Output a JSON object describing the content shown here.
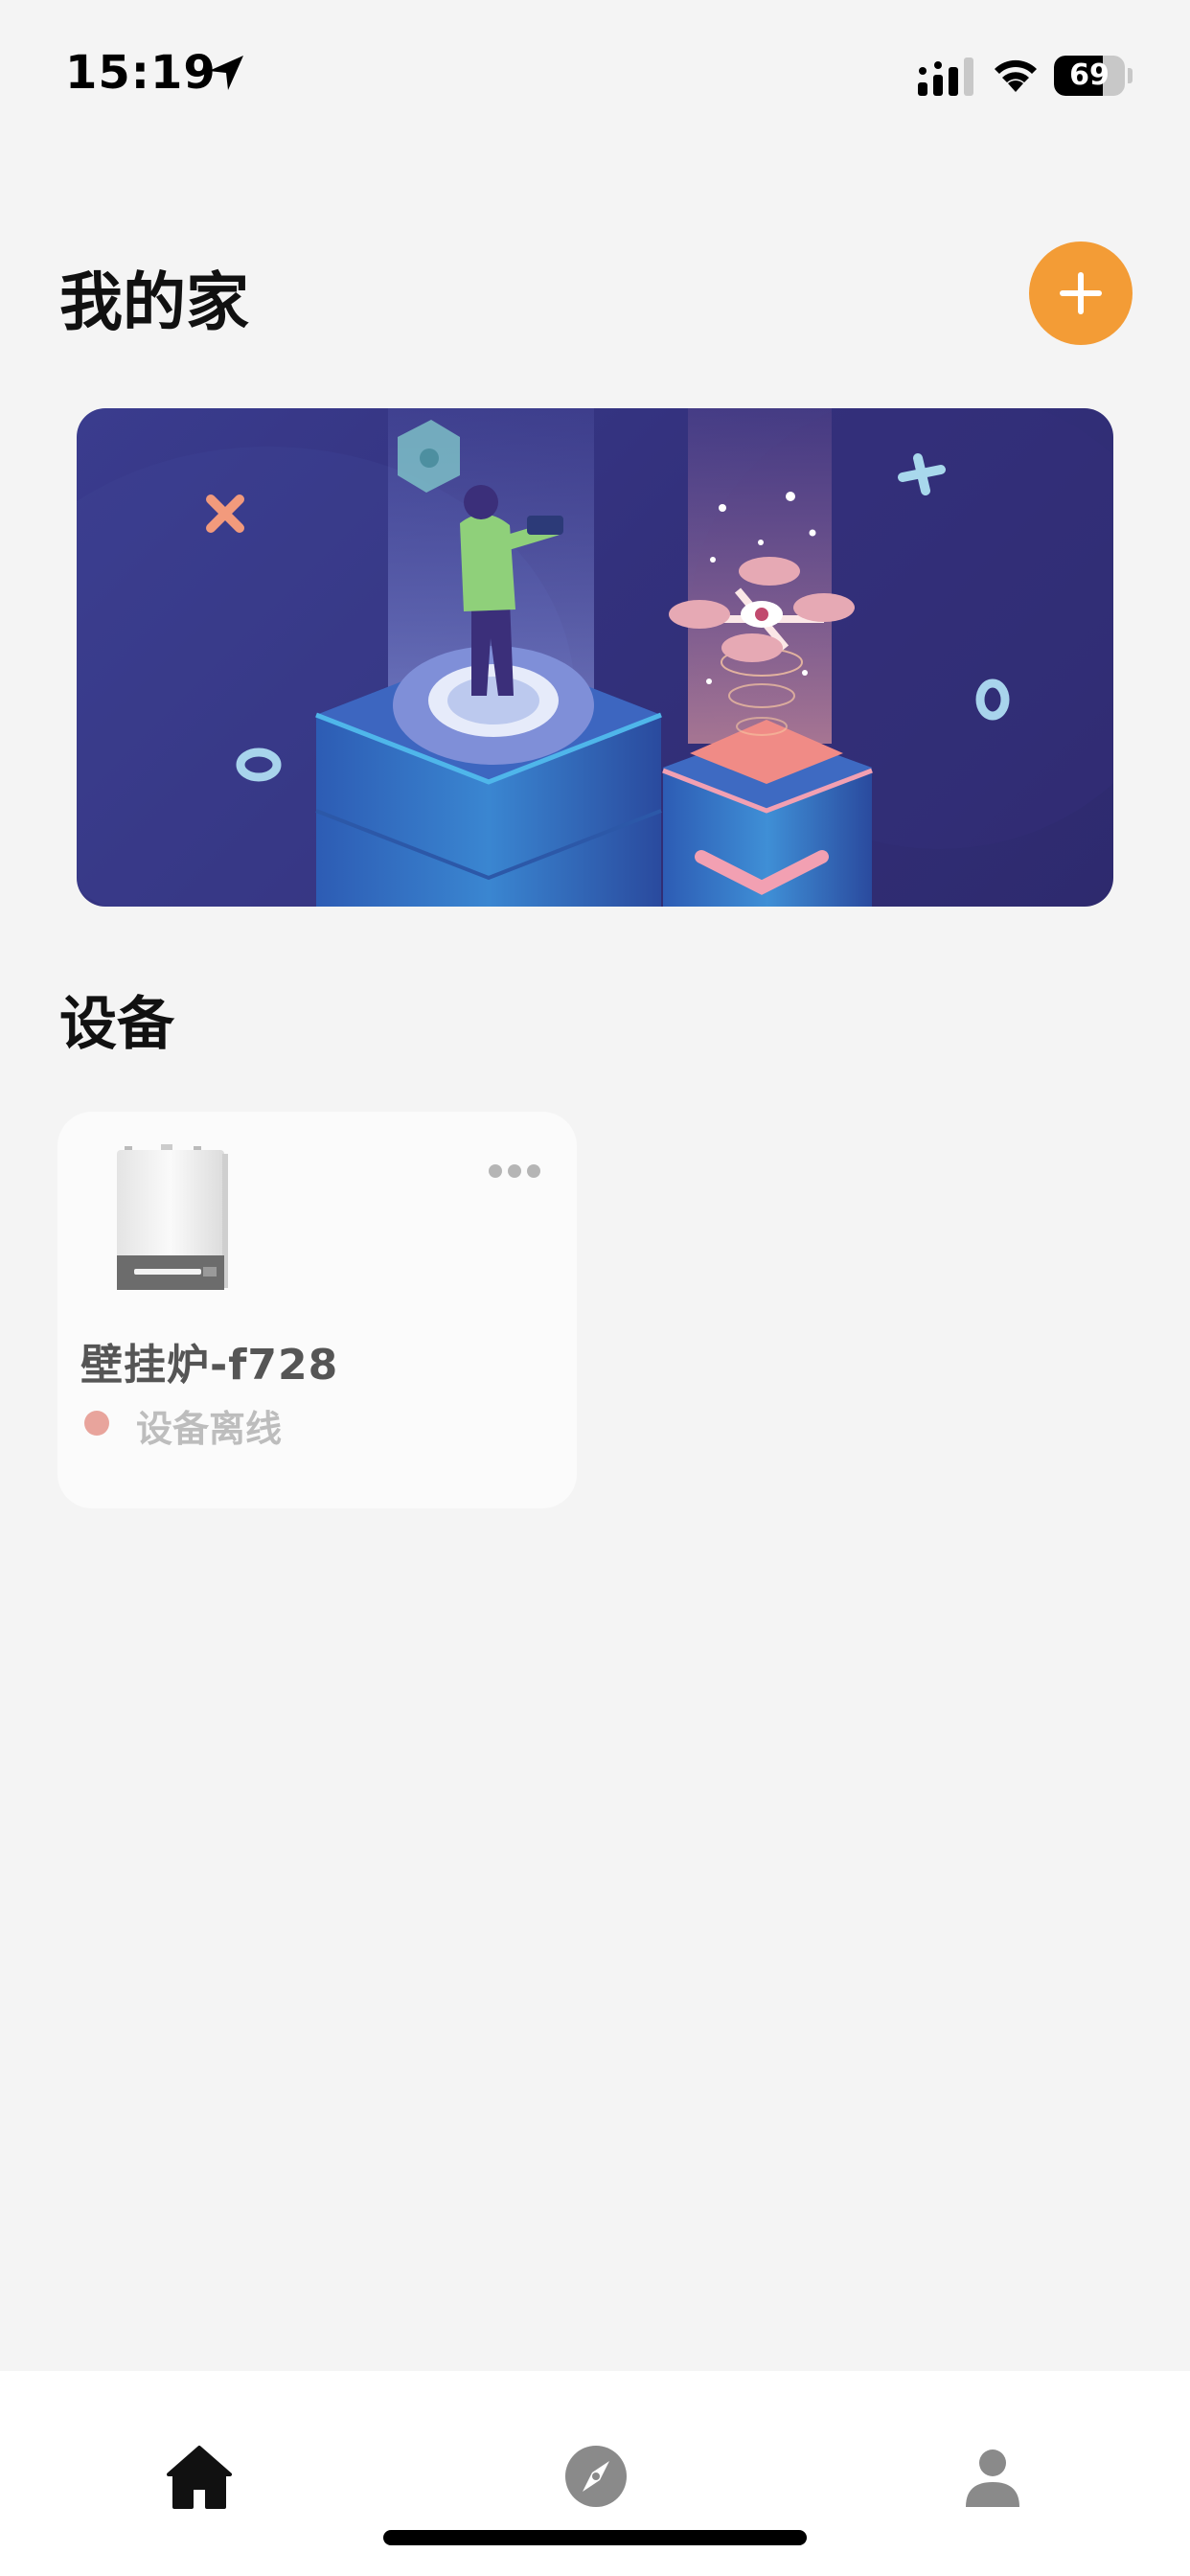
{
  "status_bar": {
    "time": "15:19",
    "battery_level": "69",
    "battery_fraction": 0.69,
    "icons": [
      "location-arrow-icon",
      "signal-icon",
      "wifi-icon",
      "battery-icon"
    ]
  },
  "header": {
    "title": "我的家",
    "add_icon": "plus-icon",
    "accent_color": "#f39c36"
  },
  "banner": {
    "illustration": "isometric-person-with-drone-illustration",
    "background_color": "#33317d"
  },
  "devices_section": {
    "title": "设备",
    "devices": [
      {
        "name": "壁挂炉-f728",
        "status": "设备离线",
        "status_color": "#e8a49c",
        "image": "wall-boiler-image",
        "more_icon": "more-dots-icon"
      }
    ]
  },
  "tab_bar": {
    "tabs": [
      {
        "icon": "home-icon",
        "active": true
      },
      {
        "icon": "compass-icon",
        "active": false
      },
      {
        "icon": "person-icon",
        "active": false
      }
    ]
  }
}
